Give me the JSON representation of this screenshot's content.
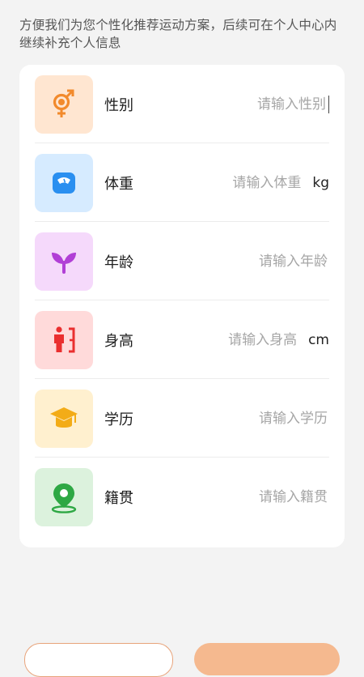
{
  "intro": "方便我们为您个性化推荐运动方案，后续可在个人中心内继续补充个人信息",
  "fields": [
    {
      "label": "性别",
      "placeholder": "请输入性别",
      "unit": "",
      "icon": "gender-icon",
      "bg": "#ffe6d1",
      "color": "#f28a2c"
    },
    {
      "label": "体重",
      "placeholder": "请输入体重",
      "unit": "kg",
      "icon": "scale-icon",
      "bg": "#d6ebff",
      "color": "#2a8ff0"
    },
    {
      "label": "年龄",
      "placeholder": "请输入年龄",
      "unit": "",
      "icon": "sprout-icon",
      "bg": "#f5d9fb",
      "color": "#b13fd6"
    },
    {
      "label": "身高",
      "placeholder": "请输入身高",
      "unit": "cm",
      "icon": "height-icon",
      "bg": "#ffdada",
      "color": "#ea2f2f"
    },
    {
      "label": "学历",
      "placeholder": "请输入学历",
      "unit": "",
      "icon": "graduation-cap-icon",
      "bg": "#fff0cf",
      "color": "#f3ac17"
    },
    {
      "label": "籍贯",
      "placeholder": "请输入籍贯",
      "unit": "",
      "icon": "location-pin-icon",
      "bg": "#dcf2dd",
      "color": "#2ea844"
    }
  ]
}
